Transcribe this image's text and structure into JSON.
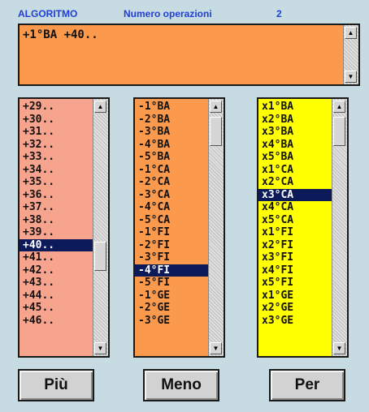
{
  "header": {
    "algoritmo_label": "ALGORITMO",
    "operazioni_label": "Numero operazioni",
    "operazioni_count": "2"
  },
  "algorithm_text": "+1°BA +40..",
  "lists": {
    "piu": {
      "items": [
        "+29..",
        "+30..",
        "+31..",
        "+32..",
        "+33..",
        "+34..",
        "+35..",
        "+36..",
        "+37..",
        "+38..",
        "+39..",
        "+40..",
        "+41..",
        "+42..",
        "+43..",
        "+44..",
        "+45..",
        "+46.."
      ],
      "selected": "+40.."
    },
    "meno": {
      "items": [
        "-1°BA",
        "-2°BA",
        "-3°BA",
        "-4°BA",
        "-5°BA",
        "-1°CA",
        "-2°CA",
        "-3°CA",
        "-4°CA",
        "-5°CA",
        "-1°FI",
        "-2°FI",
        "-3°FI",
        "-4°FI",
        "-5°FI",
        "-1°GE",
        "-2°GE",
        "-3°GE"
      ],
      "selected": "-4°FI"
    },
    "per": {
      "items": [
        "x1°BA",
        "x2°BA",
        "x3°BA",
        "x4°BA",
        "x5°BA",
        "x1°CA",
        "x2°CA",
        "x3°CA",
        "x4°CA",
        "x5°CA",
        "x1°FI",
        "x2°FI",
        "x3°FI",
        "x4°FI",
        "x5°FI",
        "x1°GE",
        "x2°GE",
        "x3°GE"
      ],
      "selected": "x3°CA"
    }
  },
  "buttons": {
    "piu": "Più",
    "meno": "Meno",
    "per": "Per"
  },
  "colors": {
    "background": "#c7dbe3",
    "header_text": "#1f3fd6",
    "algorithm_box": "#fb9a4c",
    "list_piu": "#f6a48e",
    "list_meno": "#fb9a4c",
    "list_per": "#ffff00",
    "selection": "#0c1a5a"
  }
}
